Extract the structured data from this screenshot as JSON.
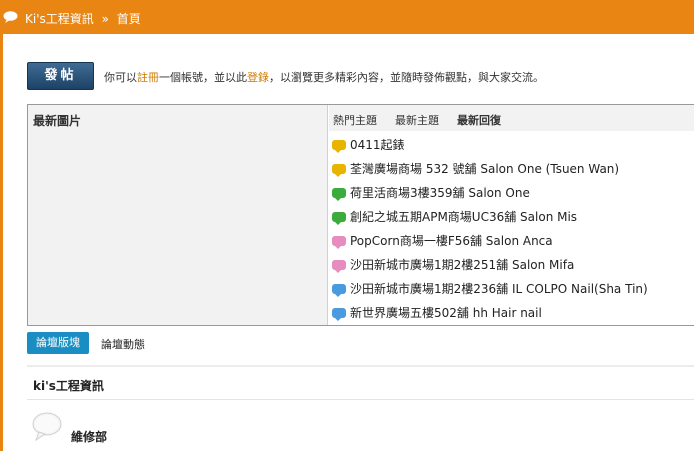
{
  "header": {
    "site_name": "Ki's工程資訊",
    "separator": "»",
    "current": "首頁"
  },
  "post_button": "發帖",
  "notice": {
    "prefix": "你可以",
    "register": "註冊",
    "middle": "一個帳號，並以此",
    "login": "登錄",
    "suffix": "，以瀏覽更多精彩內容，並隨時發佈觀點，與大家交流。"
  },
  "panel": {
    "left_title": "最新圖片",
    "tabs": [
      "熱門主題",
      "最新主題",
      "最新回復"
    ],
    "active_tab": "最新回復",
    "threads": [
      {
        "title": "0411起錶",
        "icon_color": "#e8b400"
      },
      {
        "title": "荃灣廣場商場 532 號舖 Salon One (Tsuen Wan)",
        "icon_color": "#e8b400"
      },
      {
        "title": "荷里活商場3樓359舖 Salon One",
        "icon_color": "#3bab3b"
      },
      {
        "title": "創紀之城五期APM商場UC36舖 Salon Mis",
        "icon_color": "#3bab3b"
      },
      {
        "title": "PopCorn商場一樓F56舖 Salon Anca",
        "icon_color": "#e78cbf"
      },
      {
        "title": "沙田新城市廣場1期2樓251舖 Salon Mifa",
        "icon_color": "#e78cbf"
      },
      {
        "title": "沙田新城市廣場1期2樓236舖 IL COLPO Nail(Sha Tin)",
        "icon_color": "#4a9ae0"
      },
      {
        "title": "新世界廣場五樓502舖 hh Hair nail",
        "icon_color": "#4a9ae0"
      }
    ]
  },
  "bottom_tabs": {
    "active": "論壇版塊",
    "other": "論壇動態"
  },
  "section_title": "ki's工程資訊",
  "forum": {
    "name": "維修部"
  }
}
